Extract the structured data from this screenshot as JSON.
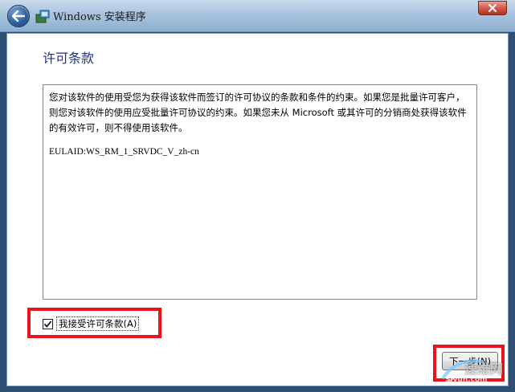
{
  "window": {
    "title": "Windows 安装程序",
    "back_icon": "back-arrow-icon",
    "close_icon": "close-icon"
  },
  "page": {
    "heading": "许可条款"
  },
  "license": {
    "body": "您对该软件的使用受您为获得该软件而签订的许可协议的条款和条件的约束。如果您是批量许可客户，则您对该软件的使用应受批量许可协议的约束。如果您未从 Microsoft 或其许可的分销商处获得该软件的有效许可，则不得使用该软件。",
    "eula_id": "EULAID:WS_RM_1_SRVDC_V_zh-cn"
  },
  "accept": {
    "label": "我接受许可条款(A)",
    "checked": true
  },
  "buttons": {
    "next_label": "下一步(N)"
  },
  "watermark": {
    "text": "速维网",
    "url": "Siyun.com"
  },
  "colors": {
    "highlight": "#e8141a",
    "heading": "#1e3287",
    "background": "#2c4f73"
  }
}
